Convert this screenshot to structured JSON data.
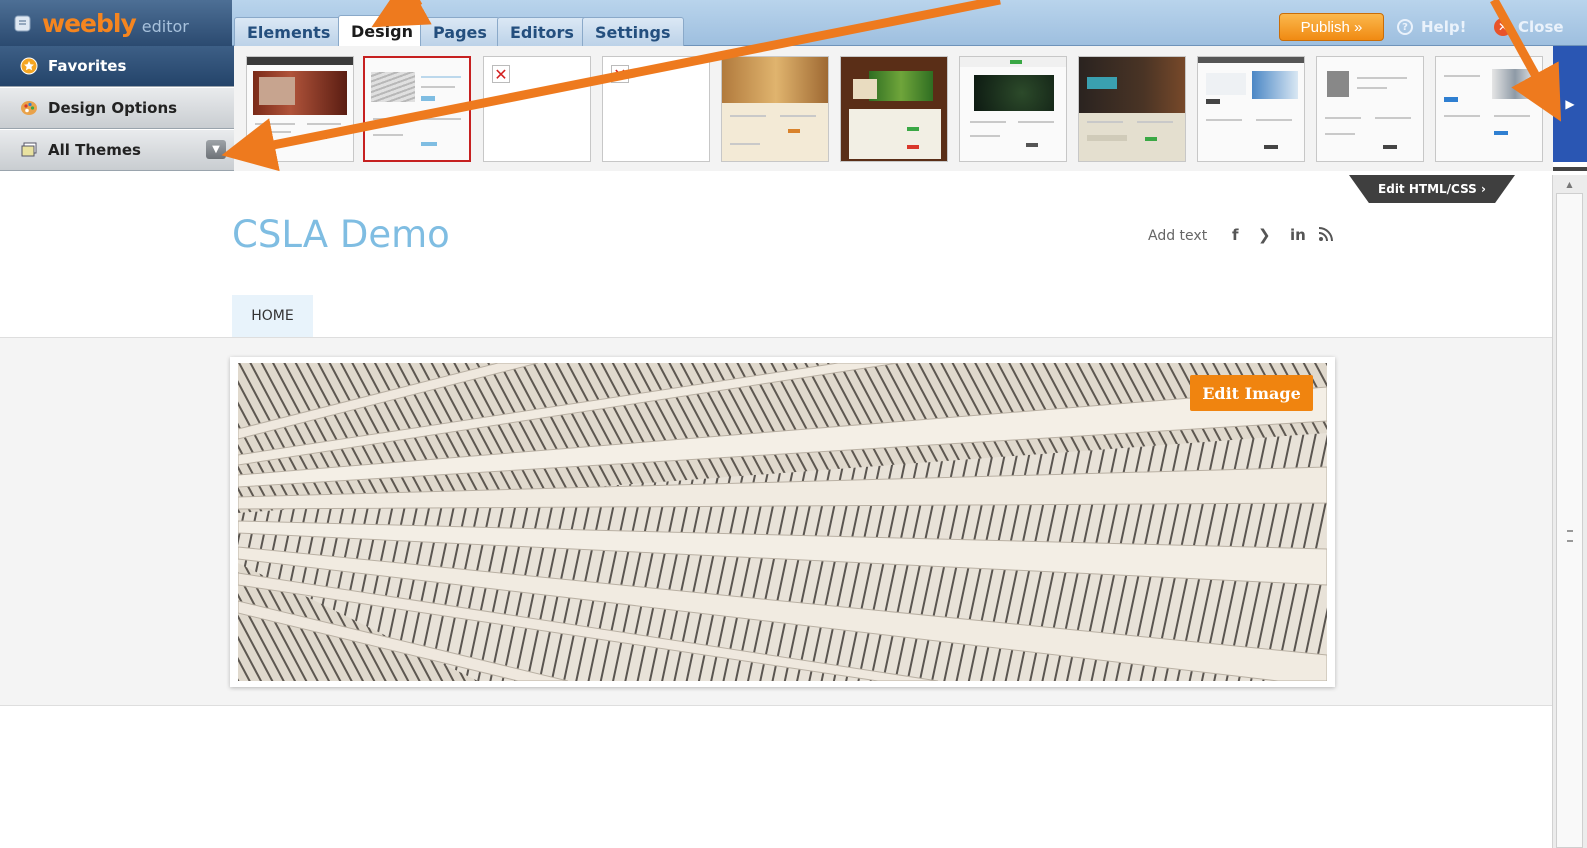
{
  "brand": {
    "name": "weebly",
    "sub": "editor"
  },
  "tabs": [
    {
      "label": "Elements"
    },
    {
      "label": "Design"
    },
    {
      "label": "Pages"
    },
    {
      "label": "Editors"
    },
    {
      "label": "Settings"
    }
  ],
  "header": {
    "publish_label": "Publish »",
    "help_label": "Help!",
    "close_label": "Close"
  },
  "sidebar": {
    "items": [
      {
        "label": "Favorites"
      },
      {
        "label": "Design Options"
      },
      {
        "label": "All Themes"
      }
    ]
  },
  "colors": {
    "accent_orange": "#f0840f",
    "title_blue": "#7fbde2",
    "selected_nav": "#2b4a70",
    "annotation": "#ee7a1e"
  },
  "editor": {
    "edit_html_label": "Edit HTML/CSS ›"
  },
  "site": {
    "title": "CSLA Demo",
    "add_text": "Add text",
    "social": [
      "f",
      "𝕏",
      "in",
      "ʼ"
    ],
    "nav": [
      {
        "label": "HOME"
      }
    ],
    "edit_image_label": "Edit Image"
  }
}
